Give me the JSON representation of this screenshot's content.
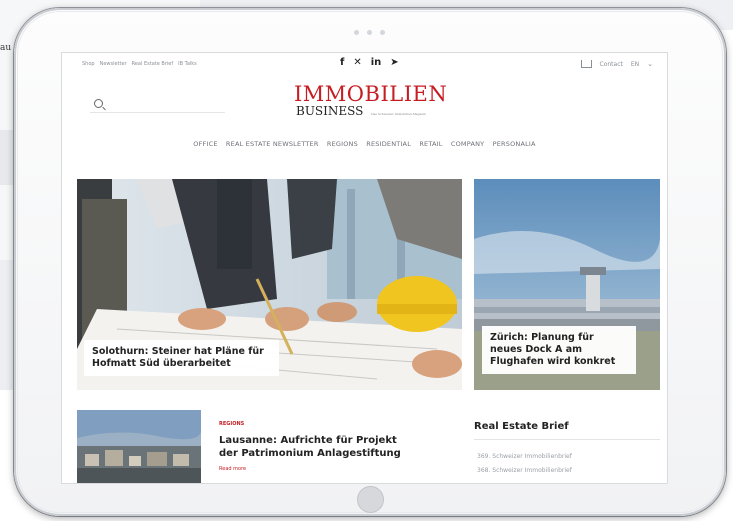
{
  "background": {
    "fragment_text": "au"
  },
  "tablet": {
    "camera_dots": 3
  },
  "site": {
    "top_links": [
      "Shop",
      "Newsletter",
      "Real Estate Brief",
      "IB Talks"
    ],
    "social_icons": [
      "facebook-icon",
      "xing-icon",
      "linkedin-icon",
      "twitter-icon"
    ],
    "social_glyphs": {
      "facebook": "f",
      "xing": "✕",
      "linkedin": "in",
      "twitter": "➤"
    },
    "contact_label": "Contact",
    "language": "EN",
    "search_placeholder": "",
    "logo": {
      "line1": "IMMOBILIEN",
      "line2": "BUSINESS",
      "tagline": "Das Schweizer Immobilien-Magazin"
    },
    "nav": [
      "OFFICE",
      "REAL ESTATE NEWSLETTER",
      "REGIONS",
      "RESIDENTIAL",
      "RETAIL",
      "COMPANY",
      "PERSONALIA"
    ],
    "hero_main": {
      "caption": "Solothurn: Steiner hat Pläne für Hofmatt Süd überarbeitet"
    },
    "hero_side": {
      "caption": "Zürich: Planung für neues Dock A am Flughafen wird konkret"
    },
    "article": {
      "category": "REGIONS",
      "title": "Lausanne: Aufrichte für Projekt der Patrimonium Anlagestiftung",
      "read_more": "Read more"
    },
    "real_estate_brief": {
      "title": "Real Estate Brief",
      "items": [
        "369. Schweizer Immobilienbrief",
        "368. Schweizer Immobilienbrief"
      ]
    }
  },
  "colors": {
    "brand_red": "#c61d23",
    "text_dark": "#222222",
    "nav_gray": "#6c7077"
  }
}
